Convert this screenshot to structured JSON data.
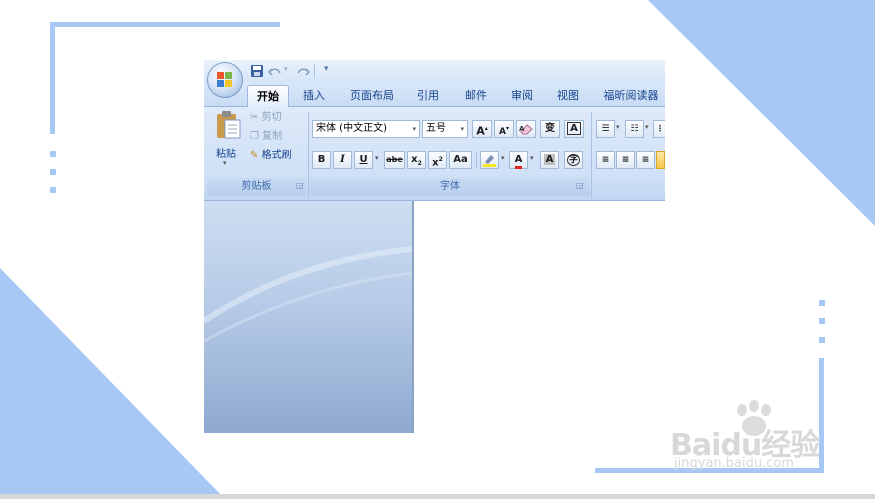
{
  "ribbon": {
    "tabs": [
      {
        "label": "开始",
        "active": true
      },
      {
        "label": "插入",
        "active": false
      },
      {
        "label": "页面布局",
        "active": false
      },
      {
        "label": "引用",
        "active": false
      },
      {
        "label": "邮件",
        "active": false
      },
      {
        "label": "审阅",
        "active": false
      },
      {
        "label": "视图",
        "active": false
      },
      {
        "label": "福昕阅读器",
        "active": false
      }
    ],
    "clipboard": {
      "paste_label": "粘贴",
      "cut_label": "剪切",
      "copy_label": "复制",
      "format_painter_label": "格式刷",
      "group_label": "剪贴板"
    },
    "font": {
      "font_name": "宋体 (中文正文)",
      "font_size": "五号",
      "grow_font": "A",
      "shrink_font": "A",
      "clear_format_icon": "eraser-icon",
      "phonetic_label": "变",
      "char_border": "A",
      "bold": "B",
      "italic": "I",
      "underline": "U",
      "strikethrough": "abe",
      "subscript": "x",
      "superscript": "x",
      "change_case": "Aa",
      "highlight_icon": "highlighter-icon",
      "font_color": "A",
      "char_shading": "A",
      "enclose_char": "字",
      "group_label": "字体"
    },
    "quick_access": {
      "save_icon": "save-icon",
      "undo_icon": "undo-icon",
      "redo_icon": "redo-icon"
    }
  },
  "watermark": {
    "brand": "Baidu经验",
    "url": "jingyan.baidu.com"
  },
  "colors": {
    "frame_accent": "#a7c8f4",
    "ribbon_text": "#15428b"
  }
}
